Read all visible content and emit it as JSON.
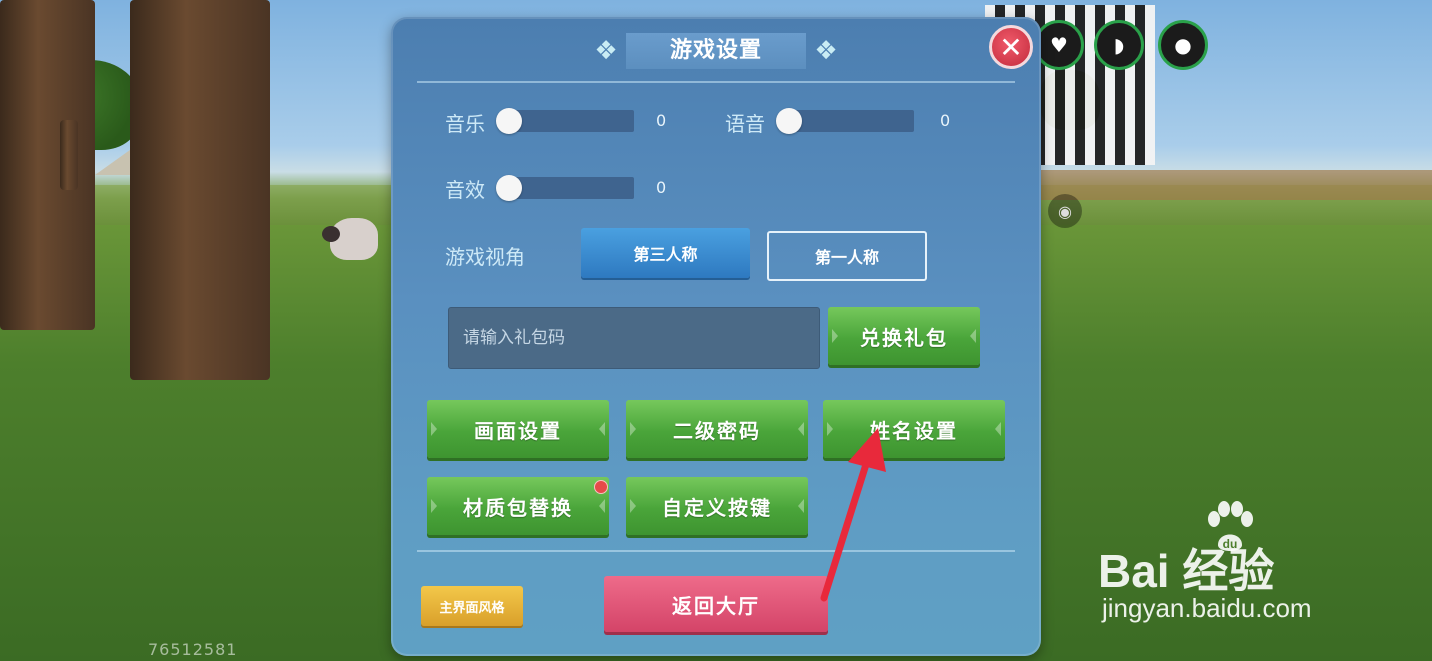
{
  "dialog": {
    "title": "游戏设置",
    "close_glyph": "✕"
  },
  "audio": {
    "music": {
      "label": "音乐",
      "value": "0",
      "level": 0
    },
    "voice": {
      "label": "语音",
      "value": "0",
      "level": 0
    },
    "sfx": {
      "label": "音效",
      "value": "0",
      "level": 0
    }
  },
  "view": {
    "label": "游戏视角",
    "options": [
      "第三人称",
      "第一人称"
    ],
    "selected": "第三人称"
  },
  "gift": {
    "placeholder": "请输入礼包码",
    "value": "",
    "redeem_label": "兑换礼包"
  },
  "buttons": {
    "graphics": "画面设置",
    "second_password": "二级密码",
    "name_settings": "姓名设置",
    "texture_pack": "材质包替换",
    "custom_keys": "自定义按键",
    "ui_style": "主界面风格",
    "return_lobby": "返回大厅"
  },
  "hud": {
    "uid": "76512581",
    "icons": [
      "heart-icon",
      "stomach-icon",
      "water-drop-icon",
      "eye-icon"
    ]
  },
  "watermark": {
    "brand": "Bai  经验",
    "url": "jingyan.baidu.com"
  },
  "colors": {
    "dialog_bg": "#5a90c0",
    "green_button": "#4aa53a",
    "selected_tab": "#2e79c0",
    "close_button": "#c22a3c",
    "return_button": "#d44468",
    "ui_style_button": "#d9a02a",
    "annotation_arrow": "#e8293b"
  }
}
